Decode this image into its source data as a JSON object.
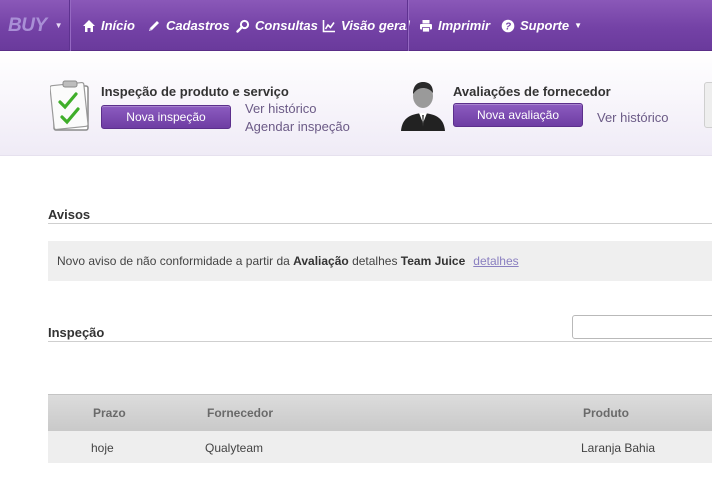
{
  "nav": {
    "brand": "BUY",
    "items": [
      {
        "label": "Início",
        "icon": "home-icon"
      },
      {
        "label": "Cadastros",
        "icon": "pencil-icon"
      },
      {
        "label": "Consultas",
        "icon": "search-icon"
      },
      {
        "label": "Visão geral",
        "icon": "chart-icon"
      },
      {
        "label": "Imprimir",
        "icon": "printer-icon"
      },
      {
        "label": "Suporte",
        "icon": "help-icon"
      }
    ]
  },
  "quick_actions": {
    "inspection": {
      "title": "Inspeção de produto e serviço",
      "button": "Nova inspeção",
      "link_history": "Ver histórico",
      "link_schedule": "Agendar inspeção",
      "icon": "clipboard-checklist-icon"
    },
    "supplier": {
      "title": "Avaliações de fornecedor",
      "button": "Nova avaliação",
      "link_history": "Ver histórico",
      "icon": "person-icon"
    }
  },
  "notices": {
    "title": "Avisos",
    "message_prefix": "Novo aviso de não conformidade a partir da ",
    "message_bold1": "Avaliação",
    "message_middle": " detalhes ",
    "message_bold2": "Team Juice",
    "details_link": "detalhes"
  },
  "inspection_section": {
    "title": "Inspeção",
    "search_value": "",
    "columns": [
      "Prazo",
      "Fornecedor",
      "Produto"
    ],
    "rows": [
      [
        "hoje",
        "Qualyteam",
        "Laranja Bahia"
      ]
    ]
  },
  "colors": {
    "nav_purple": "#7442a6",
    "button_purple": "#6e3da3"
  }
}
